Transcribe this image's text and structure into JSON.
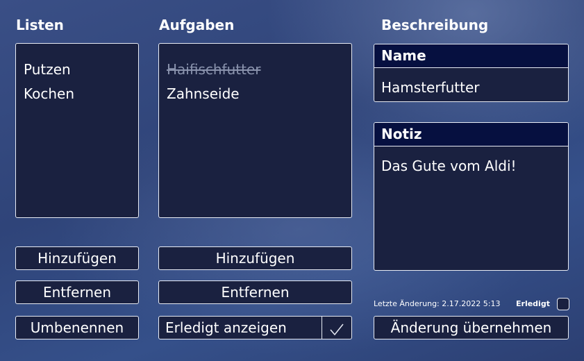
{
  "lists": {
    "heading": "Listen",
    "items": [
      "Putzen",
      "Kochen"
    ],
    "add_label": "Hinzufügen",
    "remove_label": "Entfernen",
    "rename_label": "Umbenennen"
  },
  "tasks": {
    "heading": "Aufgaben",
    "items": [
      {
        "label": "Haifischfutter",
        "done": true
      },
      {
        "label": "Zahnseide",
        "done": false
      }
    ],
    "add_label": "Hinzufügen",
    "remove_label": "Entfernen",
    "show_done_label": "Erledigt anzeigen",
    "show_done_icon": "check-icon"
  },
  "description": {
    "heading": "Beschreibung",
    "name_label": "Name",
    "name_value": "Hamsterfutter",
    "note_label": "Notiz",
    "note_value": "Das Gute vom Aldi!",
    "last_change": "Letzte Änderung: 2.17.2022 5:13",
    "done_label": "Erledigt",
    "done_checked": false,
    "apply_label": "Änderung übernehmen"
  },
  "colors": {
    "panel_bg": "#1a2140",
    "card_header_bg": "#061040",
    "border": "#e8ecf5",
    "done_text": "#8a93ad"
  }
}
